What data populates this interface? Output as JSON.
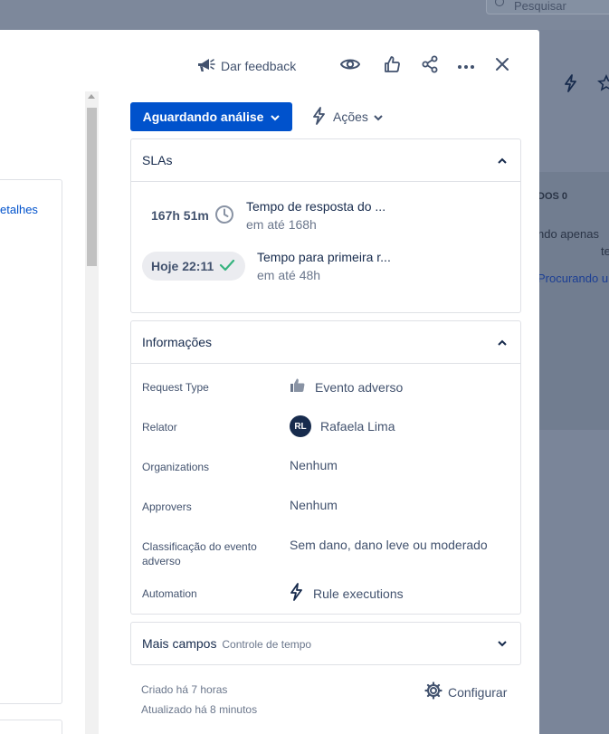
{
  "background": {
    "search_placeholder": "Pesquisar",
    "right_text_1": "DOS 0",
    "right_text_2": "ndo apenas",
    "right_text_3": "te",
    "right_text_4": "Procurando u"
  },
  "left_pane": {
    "link": "etalhes"
  },
  "header": {
    "feedback_label": "Dar feedback"
  },
  "status": {
    "label": "Aguardando análise",
    "actions_label": "Ações"
  },
  "slas": {
    "title": "SLAs",
    "items": [
      {
        "badge": "167h 51m",
        "name": "Tempo de resposta do ...",
        "target": "em até 168h",
        "state": "running"
      },
      {
        "badge": "Hoje 22:11",
        "name": "Tempo para primeira r...",
        "target": "em até 48h",
        "state": "met"
      }
    ]
  },
  "info": {
    "title": "Informações",
    "fields": [
      {
        "label": "Request Type",
        "value": "Evento adverso"
      },
      {
        "label": "Relator",
        "value": "Rafaela Lima",
        "initials": "RL"
      },
      {
        "label": "Organizations",
        "value": "Nenhum"
      },
      {
        "label": "Approvers",
        "value": "Nenhum"
      },
      {
        "label": "Classificação do evento adverso",
        "value": "Sem dano, dano leve ou moderado"
      },
      {
        "label": "Automation",
        "value": "Rule executions"
      }
    ]
  },
  "more_fields": {
    "title": "Mais campos",
    "subtitle": "Controle de tempo"
  },
  "footer": {
    "created": "Criado há 7 horas",
    "updated": "Atualizado há 8 minutos",
    "configure_label": "Configurar"
  },
  "colors": {
    "primary": "#0052cc",
    "success": "#36b37e",
    "text": "#172b4d",
    "subtle": "#6b778c"
  }
}
